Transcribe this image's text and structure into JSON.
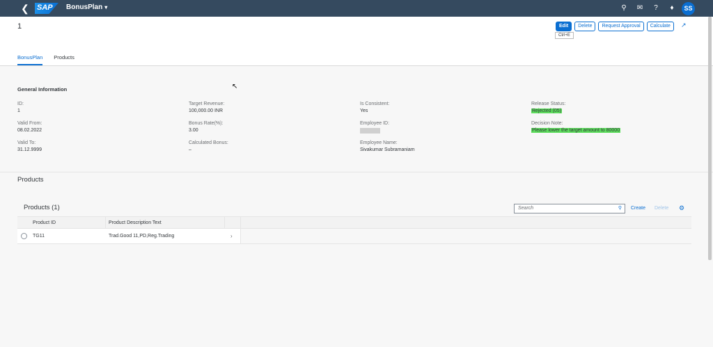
{
  "shell": {
    "app_title": "BonusPlan",
    "logo_text": "SAP",
    "avatar_initials": "SS",
    "icons": [
      "search-icon",
      "feedback-icon",
      "help-icon",
      "notification-icon"
    ]
  },
  "header": {
    "object_title": "1",
    "actions": {
      "edit": "Edit",
      "delete": "Delete",
      "request_approval": "Request Approval",
      "calculate": "Calculate"
    },
    "edit_tooltip": "Ctrl+E",
    "tabs": [
      "BonusPlan",
      "Products"
    ]
  },
  "general": {
    "title": "General Information",
    "id": {
      "label": "ID:",
      "value": "1"
    },
    "valid_from": {
      "label": "Valid From:",
      "value": "08.02.2022"
    },
    "valid_to": {
      "label": "Valid To:",
      "value": "31.12.9999"
    },
    "target_revenue": {
      "label": "Target Revenue:",
      "value": "100,000.00  INR"
    },
    "bonus_rate": {
      "label": "Bonus Rate(%):",
      "value": "3.00"
    },
    "calculated_bonus": {
      "label": "Calculated Bonus:",
      "value": "–"
    },
    "is_consistent": {
      "label": "Is Consistent:",
      "value": "Yes"
    },
    "employee_id": {
      "label": "Employee ID:"
    },
    "employee_name": {
      "label": "Employee Name:",
      "value": "Sivakumar Subramaniam"
    },
    "release_status": {
      "label": "Release Status:",
      "value": "Rejected (05)"
    },
    "decision_note": {
      "label": "Decision Note:",
      "value": "Please lower the target amount to 80000"
    }
  },
  "products": {
    "section_title": "Products",
    "table_title": "Products (1)",
    "search_placeholder": "Search",
    "create_label": "Create",
    "delete_label": "Delete",
    "columns": [
      "Product ID",
      "Product Description Text"
    ],
    "rows": [
      {
        "product_id": "TG11",
        "description": "Trad.Good 11,PD,Reg.Trading"
      }
    ]
  },
  "colors": {
    "shell": "#354a5f",
    "accent": "#0a6ed1",
    "highlight": "#5dde5d"
  }
}
